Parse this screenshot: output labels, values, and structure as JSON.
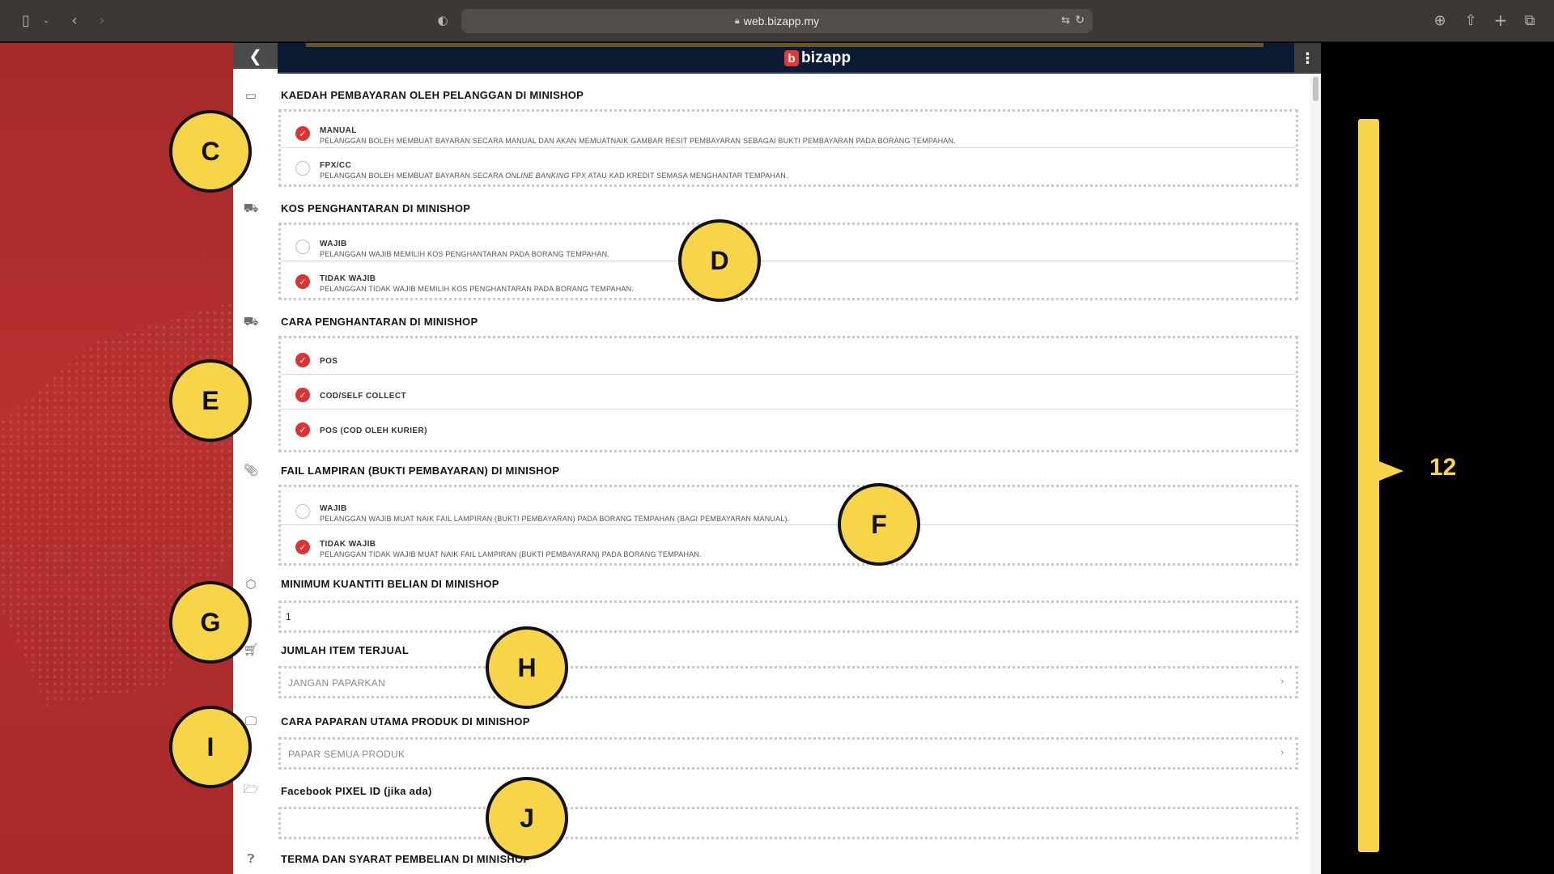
{
  "browser": {
    "url": "web.bizapp.my",
    "icons": [
      "sidebar-icon",
      "chevron-down-icon",
      "back-icon",
      "forward-icon",
      "shield-icon",
      "lock-icon",
      "translate-icon",
      "reload-icon",
      "download-icon",
      "share-icon",
      "new-tab-icon",
      "tabs-icon"
    ]
  },
  "app": {
    "logo_letter": "b",
    "logo_text": "bizapp"
  },
  "sections": {
    "payment": {
      "title": "KAEDAH PEMBAYARAN OLEH PELANGGAN DI MINISHOP",
      "options": [
        {
          "label": "MANUAL",
          "desc": "PELANGGAN BOLEH MEMBUAT BAYARAN SECARA MANUAL DAN AKAN MEMUATNAIK GAMBAR RESIT PEMBAYARAN SEBAGAI BUKTI PEMBAYARAN PADA BORANG TEMPAHAN.",
          "checked": true
        },
        {
          "label": "FPX/CC",
          "desc_pre": "PELANGGAN BOLEH MEMBUAT BAYARAN SECARA ",
          "desc_em": "ONLINE BANKING",
          "desc_post": " FPX ATAU KAD KREDIT SEMASA MENGHANTAR TEMPAHAN.",
          "checked": false
        }
      ]
    },
    "shipping_cost": {
      "title": "KOS PENGHANTARAN DI MINISHOP",
      "options": [
        {
          "label": "WAJIB",
          "desc": "PELANGGAN WAJIB MEMILIH KOS PENGHANTARAN PADA BORANG TEMPAHAN.",
          "checked": false
        },
        {
          "label": "TIDAK WAJIB",
          "desc": "PELANGGAN TIDAK WAJIB MEMILIH KOS PENGHANTARAN PADA BORANG TEMPAHAN.",
          "checked": true
        }
      ]
    },
    "delivery_method": {
      "title": "CARA PENGHANTARAN DI MINISHOP",
      "options": [
        {
          "label": "POS",
          "checked": true
        },
        {
          "label": "COD/SELF COLLECT",
          "checked": true
        },
        {
          "label": "POS (COD OLEH KURIER)",
          "checked": true
        }
      ]
    },
    "attachment": {
      "title": "FAIL LAMPIRAN (BUKTI PEMBAYARAN) DI MINISHOP",
      "options": [
        {
          "label": "WAJIB",
          "desc": "PELANGGAN WAJIB MUAT NAIK FAIL LAMPIRAN (BUKTI PEMBAYARAN) PADA BORANG TEMPAHAN (BAGI PEMBAYARAN MANUAL).",
          "checked": false
        },
        {
          "label": "TIDAK WAJIB",
          "desc": "PELANGGAN TIDAK WAJIB MUAT NAIK FAIL LAMPIRAN (BUKTI PEMBAYARAN) PADA BORANG TEMPAHAN.",
          "checked": true
        }
      ]
    },
    "min_qty": {
      "title": "MINIMUM KUANTITI BELIAN DI MINISHOP",
      "value": "1"
    },
    "items_sold": {
      "title": "JUMLAH ITEM TERJUAL",
      "value": "JANGAN PAPARKAN"
    },
    "display_mode": {
      "title": "CARA PAPARAN UTAMA PRODUK DI MINISHOP",
      "value": "PAPAR SEMUA PRODUK"
    },
    "pixel": {
      "title": "Facebook PIXEL ID (jika ada)",
      "value": ""
    },
    "terms": {
      "title": "TERMA DAN SYARAT PEMBELIAN DI MINISHOP"
    }
  },
  "annotations": {
    "callouts": [
      "C",
      "D",
      "E",
      "F",
      "G",
      "H",
      "I",
      "J"
    ],
    "bracket_label": "12",
    "color": "#f8d548"
  },
  "colors": {
    "accent_red": "#df3333",
    "banner_navy": "#0b1b34",
    "background_red": "#b83030"
  }
}
